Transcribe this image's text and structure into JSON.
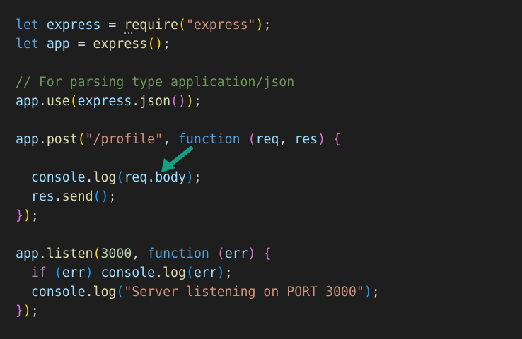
{
  "colors": {
    "background": "#1e1e1e",
    "keyword_blue": "#569cd6",
    "keyword_control": "#c586c0",
    "variable": "#9cdcfe",
    "function": "#dcdcaa",
    "string": "#ce9178",
    "number": "#b5cea8",
    "comment": "#6a9955",
    "punct": "#d4d4d4",
    "bracket_yellow": "#ffd700",
    "bracket_purple": "#da70d6",
    "bracket_blue": "#179fff",
    "arrow": "#14a085"
  },
  "icons": {
    "annotation": "arrow-pointing-down-left-icon"
  },
  "code": [
    [
      [
        "let",
        "keyword_blue"
      ],
      [
        " ",
        "punct"
      ],
      [
        "express",
        "variable"
      ],
      [
        " = ",
        "punct"
      ],
      [
        "require",
        "function"
      ],
      [
        "(",
        "bracket_yellow"
      ],
      [
        "\"express\"",
        "string"
      ],
      [
        ")",
        "bracket_yellow"
      ],
      [
        ";",
        "punct"
      ]
    ],
    [
      [
        "let",
        "keyword_blue"
      ],
      [
        " ",
        "punct"
      ],
      [
        "app",
        "variable"
      ],
      [
        " = ",
        "punct"
      ],
      [
        "express",
        "function"
      ],
      [
        "()",
        "bracket_yellow"
      ],
      [
        ";",
        "punct"
      ]
    ],
    [],
    [
      [
        "// For parsing type application/json",
        "comment"
      ]
    ],
    [
      [
        "app",
        "variable"
      ],
      [
        ".",
        "punct"
      ],
      [
        "use",
        "function"
      ],
      [
        "(",
        "bracket_yellow"
      ],
      [
        "express",
        "variable"
      ],
      [
        ".",
        "punct"
      ],
      [
        "json",
        "function"
      ],
      [
        "()",
        "bracket_purple"
      ],
      [
        ")",
        "bracket_yellow"
      ],
      [
        ";",
        "punct"
      ]
    ],
    [],
    [
      [
        "app",
        "variable"
      ],
      [
        ".",
        "punct"
      ],
      [
        "post",
        "function"
      ],
      [
        "(",
        "bracket_yellow"
      ],
      [
        "\"/profile\"",
        "string"
      ],
      [
        ", ",
        "punct"
      ],
      [
        "function",
        "keyword_blue"
      ],
      [
        " ",
        "punct"
      ],
      [
        "(",
        "bracket_purple"
      ],
      [
        "req",
        "variable"
      ],
      [
        ", ",
        "punct"
      ],
      [
        "res",
        "variable"
      ],
      [
        ")",
        "bracket_purple"
      ],
      [
        " ",
        "punct"
      ],
      [
        "{",
        "bracket_purple"
      ]
    ],
    [],
    [
      [
        "  ",
        "punct"
      ],
      [
        "console",
        "variable"
      ],
      [
        ".",
        "punct"
      ],
      [
        "log",
        "function"
      ],
      [
        "(",
        "bracket_blue"
      ],
      [
        "req",
        "variable"
      ],
      [
        ".",
        "punct"
      ],
      [
        "body",
        "variable"
      ],
      [
        ")",
        "bracket_blue"
      ],
      [
        ";",
        "punct"
      ]
    ],
    [
      [
        "  ",
        "punct"
      ],
      [
        "res",
        "variable"
      ],
      [
        ".",
        "punct"
      ],
      [
        "send",
        "function"
      ],
      [
        "()",
        "bracket_blue"
      ],
      [
        ";",
        "punct"
      ]
    ],
    [
      [
        "}",
        "bracket_purple"
      ],
      [
        ")",
        "bracket_yellow"
      ],
      [
        ";",
        "punct"
      ]
    ],
    [],
    [
      [
        "app",
        "variable"
      ],
      [
        ".",
        "punct"
      ],
      [
        "listen",
        "function"
      ],
      [
        "(",
        "bracket_yellow"
      ],
      [
        "3000",
        "number"
      ],
      [
        ", ",
        "punct"
      ],
      [
        "function",
        "keyword_blue"
      ],
      [
        " ",
        "punct"
      ],
      [
        "(",
        "bracket_purple"
      ],
      [
        "err",
        "variable"
      ],
      [
        ")",
        "bracket_purple"
      ],
      [
        " ",
        "punct"
      ],
      [
        "{",
        "bracket_purple"
      ]
    ],
    [
      [
        "  ",
        "punct"
      ],
      [
        "if",
        "keyword_control"
      ],
      [
        " ",
        "punct"
      ],
      [
        "(",
        "bracket_blue"
      ],
      [
        "err",
        "variable"
      ],
      [
        ")",
        "bracket_blue"
      ],
      [
        " ",
        "punct"
      ],
      [
        "console",
        "variable"
      ],
      [
        ".",
        "punct"
      ],
      [
        "log",
        "function"
      ],
      [
        "(",
        "bracket_blue"
      ],
      [
        "err",
        "variable"
      ],
      [
        ")",
        "bracket_blue"
      ],
      [
        ";",
        "punct"
      ]
    ],
    [
      [
        "  ",
        "punct"
      ],
      [
        "console",
        "variable"
      ],
      [
        ".",
        "punct"
      ],
      [
        "log",
        "function"
      ],
      [
        "(",
        "bracket_blue"
      ],
      [
        "\"Server listening on PORT 3000\"",
        "string"
      ],
      [
        ")",
        "bracket_blue"
      ],
      [
        ";",
        "punct"
      ]
    ],
    [
      [
        "}",
        "bracket_purple"
      ],
      [
        ")",
        "bracket_yellow"
      ],
      [
        ";",
        "punct"
      ]
    ]
  ]
}
